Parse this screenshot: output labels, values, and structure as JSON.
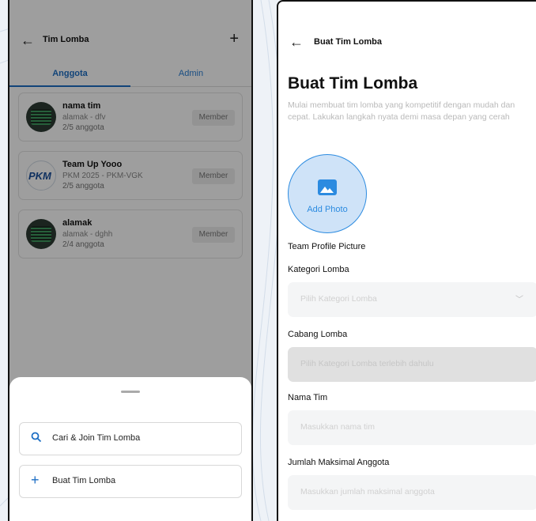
{
  "left_screen": {
    "header": {
      "title": "Tim Lomba",
      "back_icon": "arrow-left-icon",
      "add_icon": "plus-icon"
    },
    "tabs": [
      {
        "label": "Anggota",
        "active": true
      },
      {
        "label": "Admin",
        "active": false
      }
    ],
    "teams": [
      {
        "name": "nama tim",
        "subtitle": "alamak - dfv",
        "members": "2/5 anggota",
        "role": "Member"
      },
      {
        "name": "Team Up Yooo",
        "subtitle": "PKM 2025 - PKM-VGK",
        "members": "2/5 anggota",
        "role": "Member",
        "logo_text": "PKM"
      },
      {
        "name": "alamak",
        "subtitle": "alamak - dghh",
        "members": "2/4 anggota",
        "role": "Member"
      }
    ],
    "sheet": {
      "actions": [
        {
          "label": "Cari & Join Tim Lomba",
          "icon": "search-icon"
        },
        {
          "label": "Buat Tim Lomba",
          "icon": "plus-icon"
        }
      ]
    }
  },
  "right_screen": {
    "header": {
      "title": "Buat Tim Lomba",
      "back_icon": "arrow-left-icon"
    },
    "heading": "Buat Tim Lomba",
    "description": "Mulai membuat tim lomba yang kompetitif dengan mudah dan cepat. Lakukan langkah nyata demi masa depan yang cerah",
    "photo": {
      "label": "Add Photo",
      "icon": "image-icon",
      "caption": "Team Profile Picture"
    },
    "fields": [
      {
        "label": "Kategori Lomba",
        "placeholder": "Pilih Kategori Lomba",
        "type": "select"
      },
      {
        "label": "Cabang Lomba",
        "placeholder": "Pilih Kategori Lomba terlebih dahulu",
        "type": "select",
        "disabled": true
      },
      {
        "label": "Nama Tim",
        "placeholder": "Masukkan nama tim",
        "type": "text"
      },
      {
        "label": "Jumlah Maksimal Anggota",
        "placeholder": "Masukkan jumlah maksimal anggota",
        "type": "text"
      }
    ]
  },
  "colors": {
    "primary": "#1e6fc4",
    "accent": "#2c8be0",
    "muted_text": "#b9b9b9"
  }
}
